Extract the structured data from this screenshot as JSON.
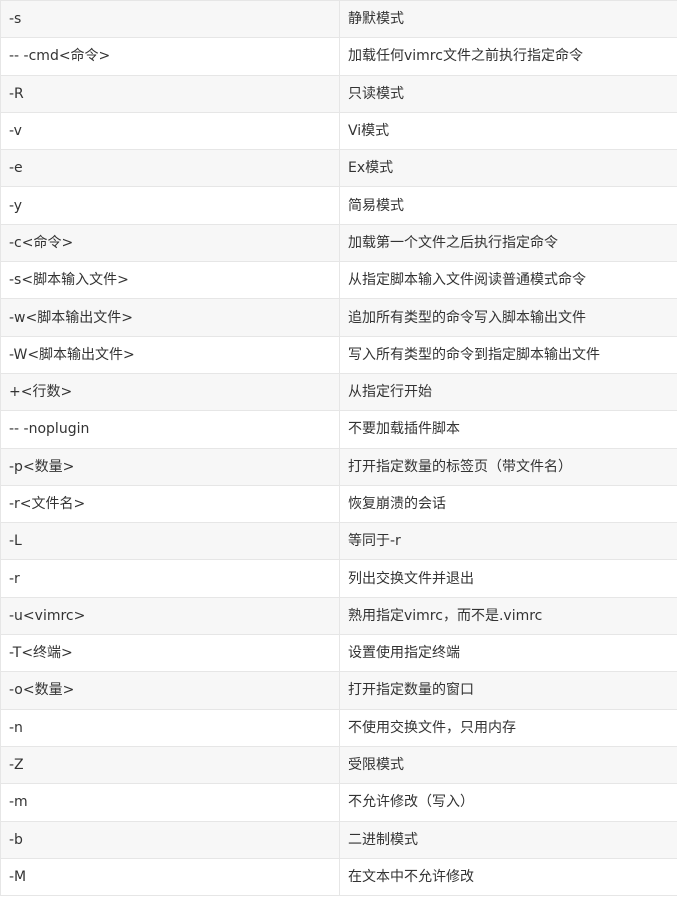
{
  "rows": [
    {
      "option": "-s",
      "description": "静默模式"
    },
    {
      "option": "-- -cmd<命令>",
      "description": "加载任何vimrc文件之前执行指定命令"
    },
    {
      "option": "-R",
      "description": "只读模式"
    },
    {
      "option": "-v",
      "description": "Vi模式"
    },
    {
      "option": "-e",
      "description": "Ex模式"
    },
    {
      "option": "-y",
      "description": "简易模式"
    },
    {
      "option": "-c<命令>",
      "description": "加载第一个文件之后执行指定命令"
    },
    {
      "option": "-s<脚本输入文件>",
      "description": "从指定脚本输入文件阅读普通模式命令"
    },
    {
      "option": "-w<脚本输出文件>",
      "description": "追加所有类型的命令写入脚本输出文件"
    },
    {
      "option": "-W<脚本输出文件>",
      "description": "写入所有类型的命令到指定脚本输出文件"
    },
    {
      "option": "+<行数>",
      "description": "从指定行开始"
    },
    {
      "option": "-- -noplugin",
      "description": "不要加载插件脚本"
    },
    {
      "option": "-p<数量>",
      "description": "打开指定数量的标签页（带文件名）"
    },
    {
      "option": "-r<文件名>",
      "description": "恢复崩溃的会话"
    },
    {
      "option": "-L",
      "description": "等同于-r"
    },
    {
      "option": "-r",
      "description": "列出交换文件并退出"
    },
    {
      "option": "-u<vimrc>",
      "description": "熟用指定vimrc，而不是.vimrc"
    },
    {
      "option": "-T<终端>",
      "description": "设置使用指定终端"
    },
    {
      "option": "-o<数量>",
      "description": "打开指定数量的窗口"
    },
    {
      "option": "-n",
      "description": "不使用交换文件，只用内存"
    },
    {
      "option": "-Z",
      "description": "受限模式"
    },
    {
      "option": "-m",
      "description": "不允许修改（写入）"
    },
    {
      "option": "-b",
      "description": "二进制模式"
    },
    {
      "option": "-M",
      "description": "在文本中不允许修改"
    }
  ]
}
